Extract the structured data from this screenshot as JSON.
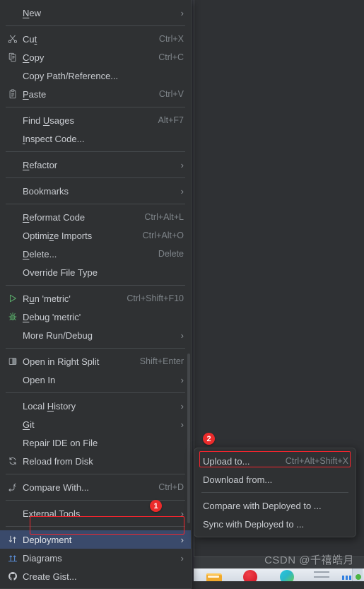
{
  "watermark": "CSDN @千禧皓月",
  "colors": {
    "menu_bg": "#2f3133",
    "selected_bg": "#3a4a6b",
    "highlight_box": "#f5252e",
    "badge_bg": "#ec2b2b",
    "text": "#c9ccd1",
    "accelerator": "#7e8489"
  },
  "badges": [
    {
      "label": "1",
      "target": "Deployment"
    },
    {
      "label": "2",
      "target": "Upload to..."
    }
  ],
  "context_menu": {
    "items": [
      {
        "icon": "none",
        "label": "New",
        "mnemonic": "N",
        "accel": "",
        "submenu": true,
        "selected": false
      },
      {
        "type": "separator"
      },
      {
        "icon": "scissors-icon",
        "label": "Cut",
        "mnemonic": "t",
        "accel": "Ctrl+X",
        "submenu": false,
        "selected": false
      },
      {
        "icon": "copy-icon",
        "label": "Copy",
        "mnemonic": "C",
        "accel": "Ctrl+C",
        "submenu": false,
        "selected": false
      },
      {
        "icon": "none",
        "label": "Copy Path/Reference...",
        "mnemonic": "",
        "accel": "",
        "submenu": false,
        "selected": false
      },
      {
        "icon": "clipboard-icon",
        "label": "Paste",
        "mnemonic": "P",
        "accel": "Ctrl+V",
        "submenu": false,
        "selected": false
      },
      {
        "type": "separator"
      },
      {
        "icon": "none",
        "label": "Find Usages",
        "mnemonic": "U",
        "accel": "Alt+F7",
        "submenu": false,
        "selected": false
      },
      {
        "icon": "none",
        "label": "Inspect Code...",
        "mnemonic": "I",
        "accel": "",
        "submenu": false,
        "selected": false
      },
      {
        "type": "separator"
      },
      {
        "icon": "none",
        "label": "Refactor",
        "mnemonic": "R",
        "accel": "",
        "submenu": true,
        "selected": false
      },
      {
        "type": "separator"
      },
      {
        "icon": "none",
        "label": "Bookmarks",
        "mnemonic": "",
        "accel": "",
        "submenu": true,
        "selected": false
      },
      {
        "type": "separator"
      },
      {
        "icon": "none",
        "label": "Reformat Code",
        "mnemonic": "R",
        "accel": "Ctrl+Alt+L",
        "submenu": false,
        "selected": false
      },
      {
        "icon": "none",
        "label": "Optimize Imports",
        "mnemonic": "z",
        "accel": "Ctrl+Alt+O",
        "submenu": false,
        "selected": false
      },
      {
        "icon": "none",
        "label": "Delete...",
        "mnemonic": "D",
        "accel": "Delete",
        "submenu": false,
        "selected": false
      },
      {
        "icon": "none",
        "label": "Override File Type",
        "mnemonic": "",
        "accel": "",
        "submenu": false,
        "selected": false
      },
      {
        "type": "separator"
      },
      {
        "icon": "run-icon",
        "label": "Run 'metric'",
        "mnemonic": "u",
        "accel": "Ctrl+Shift+F10",
        "submenu": false,
        "selected": false
      },
      {
        "icon": "debug-icon",
        "label": "Debug 'metric'",
        "mnemonic": "D",
        "accel": "",
        "submenu": false,
        "selected": false
      },
      {
        "icon": "none",
        "label": "More Run/Debug",
        "mnemonic": "",
        "accel": "",
        "submenu": true,
        "selected": false
      },
      {
        "type": "separator"
      },
      {
        "icon": "split-icon",
        "label": "Open in Right Split",
        "mnemonic": "",
        "accel": "Shift+Enter",
        "submenu": false,
        "selected": false
      },
      {
        "icon": "none",
        "label": "Open In",
        "mnemonic": "",
        "accel": "",
        "submenu": true,
        "selected": false
      },
      {
        "type": "separator"
      },
      {
        "icon": "none",
        "label": "Local History",
        "mnemonic": "H",
        "accel": "",
        "submenu": true,
        "selected": false
      },
      {
        "icon": "none",
        "label": "Git",
        "mnemonic": "G",
        "accel": "",
        "submenu": true,
        "selected": false
      },
      {
        "icon": "none",
        "label": "Repair IDE on File",
        "mnemonic": "",
        "accel": "",
        "submenu": false,
        "selected": false
      },
      {
        "icon": "reload-icon",
        "label": "Reload from Disk",
        "mnemonic": "",
        "accel": "",
        "submenu": false,
        "selected": false
      },
      {
        "type": "separator"
      },
      {
        "icon": "compare-icon",
        "label": "Compare With...",
        "mnemonic": "",
        "accel": "Ctrl+D",
        "submenu": false,
        "selected": false
      },
      {
        "type": "separator"
      },
      {
        "icon": "none",
        "label": "External Tools",
        "mnemonic": "",
        "accel": "",
        "submenu": true,
        "selected": false
      },
      {
        "type": "separator"
      },
      {
        "icon": "deployment-icon",
        "label": "Deployment",
        "mnemonic": "",
        "accel": "",
        "submenu": true,
        "selected": true
      },
      {
        "icon": "diagrams-icon",
        "label": "Diagrams",
        "mnemonic": "",
        "accel": "",
        "submenu": true,
        "selected": false
      },
      {
        "icon": "github-icon",
        "label": "Create Gist...",
        "mnemonic": "",
        "accel": "",
        "submenu": false,
        "selected": false
      }
    ]
  },
  "submenu": {
    "items": [
      {
        "label": "Upload to...",
        "accel": "Ctrl+Alt+Shift+X",
        "highlighted": true
      },
      {
        "label": "Download from...",
        "accel": "",
        "highlighted": false
      },
      {
        "type": "separator"
      },
      {
        "label": "Compare with Deployed to ...",
        "accel": "",
        "highlighted": false
      },
      {
        "label": "Sync with Deployed to ...",
        "accel": "",
        "highlighted": false
      }
    ]
  }
}
